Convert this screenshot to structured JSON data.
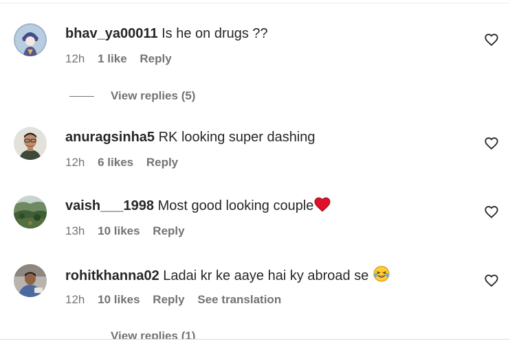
{
  "comments": [
    {
      "username": "bhav_ya00011",
      "text": "Is he on drugs ??",
      "time": "12h",
      "likes": "1 like",
      "reply_label": "Reply",
      "avatar_icon": "anime-character-avatar"
    },
    {
      "username": "anuragsinha5",
      "text": "RK looking super dashing",
      "time": "12h",
      "likes": "6 likes",
      "reply_label": "Reply",
      "avatar_icon": "man-with-glasses-avatar"
    },
    {
      "username": "vaish___1998",
      "text": "Most good looking couple",
      "time": "13h",
      "likes": "10 likes",
      "reply_label": "Reply",
      "emoji": "red-heart",
      "avatar_icon": "landscape-avatar"
    },
    {
      "username": "rohitkhanna02",
      "text": "Ladai kr ke aaye hai ky abroad se",
      "time": "12h",
      "likes": "10 likes",
      "reply_label": "Reply",
      "translation_label": "See translation",
      "emoji": "laughing-with-tears",
      "avatar_icon": "person-avatar"
    }
  ],
  "view_replies": [
    {
      "label": "View replies (5)"
    },
    {
      "label": "View replies (1)"
    }
  ],
  "colors": {
    "text": "#262626",
    "secondary": "#737373",
    "heart": "#e0102b"
  }
}
